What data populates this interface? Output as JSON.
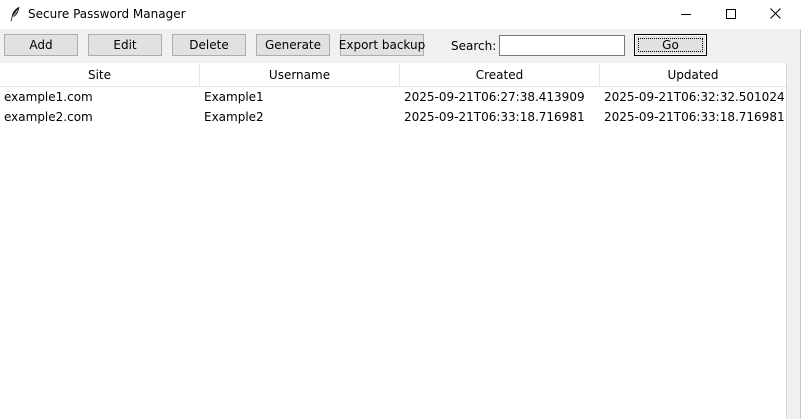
{
  "window": {
    "title": "Secure Password Manager",
    "icon": "feather-icon",
    "controls": [
      "minimize-icon",
      "maximize-icon",
      "close-icon"
    ]
  },
  "toolbar": {
    "add_label": "Add",
    "edit_label": "Edit",
    "delete_label": "Delete",
    "generate_label": "Generate",
    "export_label": "Export backup",
    "search_label": "Search:",
    "search_value": "",
    "go_label": "Go"
  },
  "table": {
    "columns": [
      "Site",
      "Username",
      "Created",
      "Updated"
    ],
    "rows": [
      [
        "example1.com",
        "Example1",
        "2025-09-21T06:27:38.413909",
        "2025-09-21T06:32:32.501024"
      ],
      [
        "example2.com",
        "Example2",
        "2025-09-21T06:33:18.716981",
        "2025-09-21T06:33:18.716981"
      ]
    ]
  }
}
